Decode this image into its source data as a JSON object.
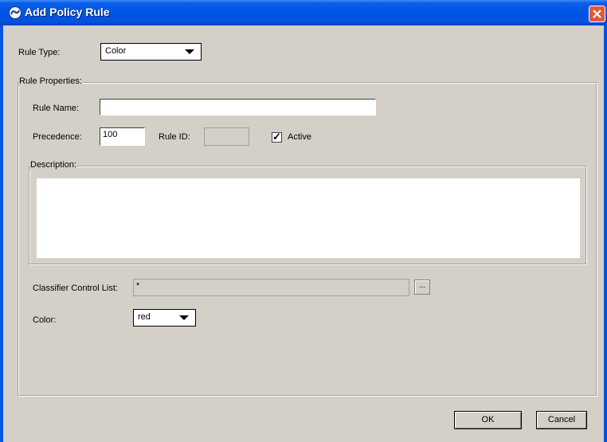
{
  "window": {
    "title": "Add Policy Rule"
  },
  "rule_type": {
    "label": "Rule Type:",
    "value": "Color"
  },
  "rule_properties": {
    "legend": "Rule Properties:",
    "rule_name": {
      "label": "Rule Name:",
      "value": ""
    },
    "precedence": {
      "label": "Precedence:",
      "value": "100"
    },
    "rule_id": {
      "label": "Rule ID:",
      "value": ""
    },
    "active": {
      "label": "Active",
      "checked": true
    },
    "description": {
      "legend": "Description:",
      "value": ""
    },
    "classifier": {
      "label": "Classifier Control List:",
      "value": "*",
      "browse_label": "..."
    },
    "color": {
      "label": "Color:",
      "value": "red"
    }
  },
  "buttons": {
    "ok": "OK",
    "cancel": "Cancel"
  },
  "colors": {
    "titlebar": "#0054e3",
    "dialog_bg": "#d4d0c8",
    "close": "#e1593a"
  }
}
